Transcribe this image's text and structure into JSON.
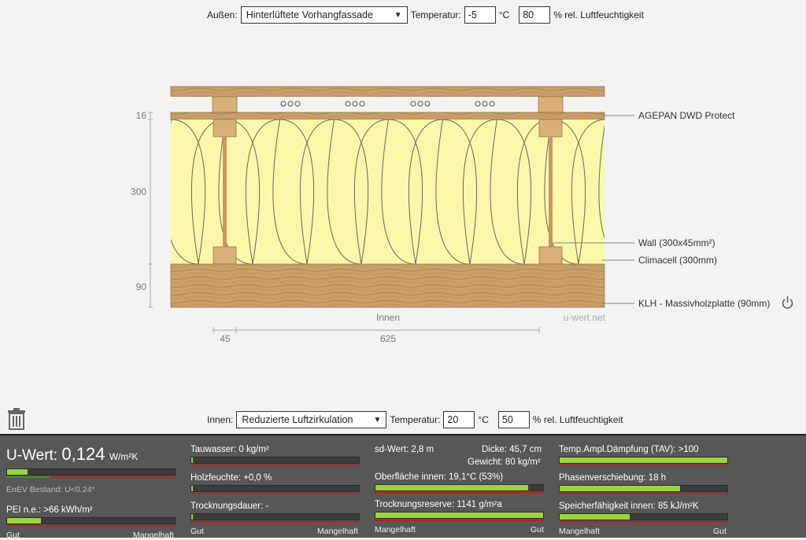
{
  "outside": {
    "label": "Außen:",
    "mode": "Hinterlüftete Vorhangfassade",
    "temp_label": "Temperatur:",
    "temp": "-5",
    "temp_unit": "°C",
    "humidity": "80",
    "humidity_unit": "% rel. Luftfeuchtigkeit"
  },
  "inside": {
    "label": "Innen:",
    "mode": "Reduzierte Luftzirkulation",
    "temp_label": "Temperatur:",
    "temp": "20",
    "temp_unit": "°C",
    "humidity": "50",
    "humidity_unit": "% rel. Luftfeuchtigkeit"
  },
  "diagram": {
    "dim_left": [
      "16",
      "300",
      "90"
    ],
    "dim_bottom": [
      "45",
      "625"
    ],
    "inside_label": "Innen",
    "watermark": "u-wert.net",
    "layers": [
      "AGEPAN DWD Protect",
      "Wall (300x45mm²)",
      "Climacell (300mm)",
      "KLH - Massivholzplatte (90mm)"
    ],
    "colors": {
      "wood": "#c9a06a",
      "insulation": "#fbf7a8",
      "stud": "#d9b07a"
    }
  },
  "results": {
    "u_label": "U-Wert:",
    "u_value": "0,124",
    "u_unit": "W/m²K",
    "u_level": 0.12,
    "enev": "EnEV Bestand: U<0.24*",
    "pei": "PEI n.e.: >66 kWh/m²",
    "pei_level": 0.2,
    "tauwasser": "Tauwasser: 0 kg/m²",
    "tauwasser_level": 0.01,
    "holzfeuchte": "Holzfeuchte: +0,0 %",
    "holzfeuchte_level": 0.01,
    "trocknungsdauer": "Trocknungsdauer: -",
    "trocknungsdauer_level": 0.01,
    "sd": "sd-Wert: 2,8 m",
    "dicke": "Dicke: 45,7 cm",
    "gewicht": "Gewicht: 80 kg/m²",
    "oberflaeche": "Oberfläche innen: 19,1°C (53%)",
    "oberflaeche_level": 0.91,
    "trocknungsreserve": "Trocknungsreserve: 1141 g/m²a",
    "trocknungsreserve_level": 1.0,
    "tav": "Temp.Ampl.Dämpfung (TAV): >100",
    "tav_level": 1.0,
    "phase": "Phasenverschiebung: 18 h",
    "phase_level": 0.72,
    "speicher": "Speicherfähigkeit innen: 85 kJ/m²K",
    "speicher_level": 0.42,
    "scale_gut": "Gut",
    "scale_mangelhaft": "Mangelhaft"
  }
}
